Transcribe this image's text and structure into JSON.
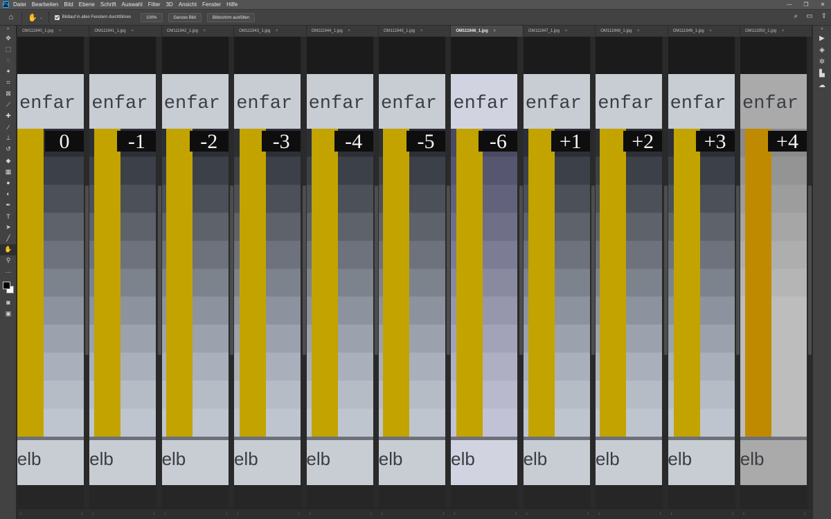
{
  "app": {
    "logo": "Ps",
    "menu": [
      "Datei",
      "Bearbeiten",
      "Bild",
      "Ebene",
      "Schrift",
      "Auswahl",
      "Filter",
      "3D",
      "Ansicht",
      "Fenster",
      "Hilfe"
    ],
    "window_controls": [
      "—",
      "❐",
      "✕"
    ]
  },
  "options": {
    "scroll_all_label": "Bildlauf in allen Fenstern durchführen",
    "scroll_all_checked": true,
    "zoom_button": "100%",
    "fit_button": "Ganzes Bild",
    "fill_button": "Bildschirm ausfüllen"
  },
  "tools": [
    "move-icon",
    "marquee-icon",
    "lasso-icon",
    "magic-wand-icon",
    "crop-icon",
    "frame-icon",
    "eyedropper-icon",
    "healing-icon",
    "brush-icon",
    "stamp-icon",
    "history-brush-icon",
    "eraser-icon",
    "gradient-icon",
    "blur-icon",
    "dodge-icon",
    "pen-icon",
    "type-icon",
    "path-select-icon",
    "line-icon",
    "hand-icon",
    "zoom-icon",
    "more-icon"
  ],
  "right_panels": [
    "play-icon",
    "layers-icon",
    "adjust-icon",
    "libraries-icon",
    "cloud-icon"
  ],
  "colors": {
    "yellow_bar": "#c2a300",
    "yellow_bar_last": "#c08a00",
    "label_bg": "#c8ccd3"
  },
  "canvas_text": {
    "top_word": "enfar",
    "bottom_word": "ielb"
  },
  "documents": [
    {
      "tab": "OM111940_1.jpg",
      "close": "×",
      "exposure": "0",
      "active": false
    },
    {
      "tab": "OM111941_1.jpg",
      "close": "×",
      "exposure": "-1",
      "active": false
    },
    {
      "tab": "OM111942_1.jpg",
      "close": "×",
      "exposure": "-2",
      "active": false
    },
    {
      "tab": "OM111943_1.jpg",
      "close": "×",
      "exposure": "-3",
      "active": false
    },
    {
      "tab": "OM111944_1.jpg",
      "close": "×",
      "exposure": "-4",
      "active": false
    },
    {
      "tab": "OM111945_1.jpg",
      "close": "×",
      "exposure": "-5",
      "active": false
    },
    {
      "tab": "OM111946_1.jpg",
      "close": "×",
      "exposure": "-6",
      "active": true
    },
    {
      "tab": "OM111947_1.jpg",
      "close": "×",
      "exposure": "+1",
      "active": false
    },
    {
      "tab": "OM111948_1.jpg",
      "close": "×",
      "exposure": "+2",
      "active": false
    },
    {
      "tab": "OM111949_1.jpg",
      "close": "×",
      "exposure": "+3",
      "active": false
    },
    {
      "tab": "OM111950_1.jpg",
      "close": "×",
      "exposure": "+4",
      "active": false
    }
  ]
}
